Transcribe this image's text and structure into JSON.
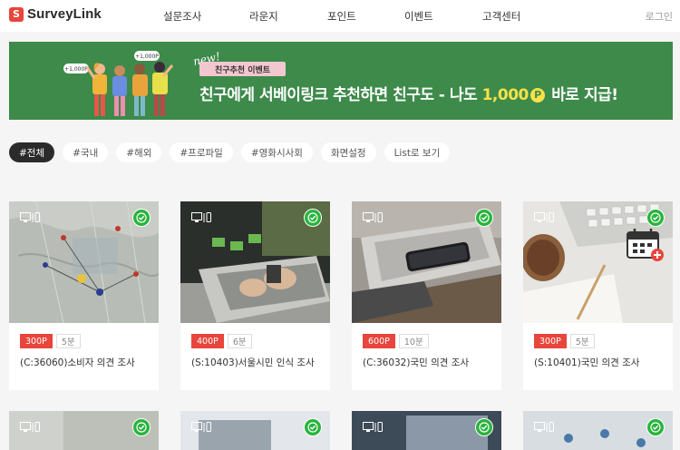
{
  "header": {
    "logo_mark": "S",
    "logo_text": "SurveyLink",
    "nav": [
      "설문조사",
      "라운지",
      "포인트",
      "이벤트",
      "고객센터"
    ],
    "login": "로그인"
  },
  "banner": {
    "new_label": "new!",
    "pill": "친구추천 이벤트",
    "headline_pre": "친구에게 서베이링크 추천하면 친구도 - 나도",
    "headline_amount": "1,000",
    "coin": "P",
    "headline_post": "바로 지급!",
    "bubble_left": "+1,000P",
    "bubble_right": "+1,000P",
    "colors": {
      "bg": "#3d8a4a",
      "accent": "#f7e24a",
      "pill": "#f3c7d0"
    }
  },
  "filters": [
    {
      "label": "#전체",
      "active": true
    },
    {
      "label": "#국내",
      "active": false
    },
    {
      "label": "#해외",
      "active": false
    },
    {
      "label": "#프로파일",
      "active": false
    },
    {
      "label": "#영화시사회",
      "active": false
    },
    {
      "label": "화면설정",
      "active": false
    },
    {
      "label": "List로 보기",
      "active": false
    }
  ],
  "cards": [
    {
      "points": "300P",
      "duration": "5분",
      "title": "(C:36060)소비자 의견 조사",
      "image": "world-map-photo"
    },
    {
      "points": "400P",
      "duration": "6분",
      "title": "(S:10403)서울시민 인식 조사",
      "image": "laptop-typing-photo"
    },
    {
      "points": "600P",
      "duration": "10분",
      "title": "(C:36032)국민 의견 조사",
      "image": "phone-on-laptop-photo"
    },
    {
      "points": "300P",
      "duration": "5분",
      "title": "(S:10401)국민 의견 조사",
      "image": "desk-keyboard-photo"
    }
  ],
  "icons": {
    "device": "desktop-mobile-icon",
    "completed": "check-circle-icon",
    "calendar": "calendar-add-icon"
  }
}
